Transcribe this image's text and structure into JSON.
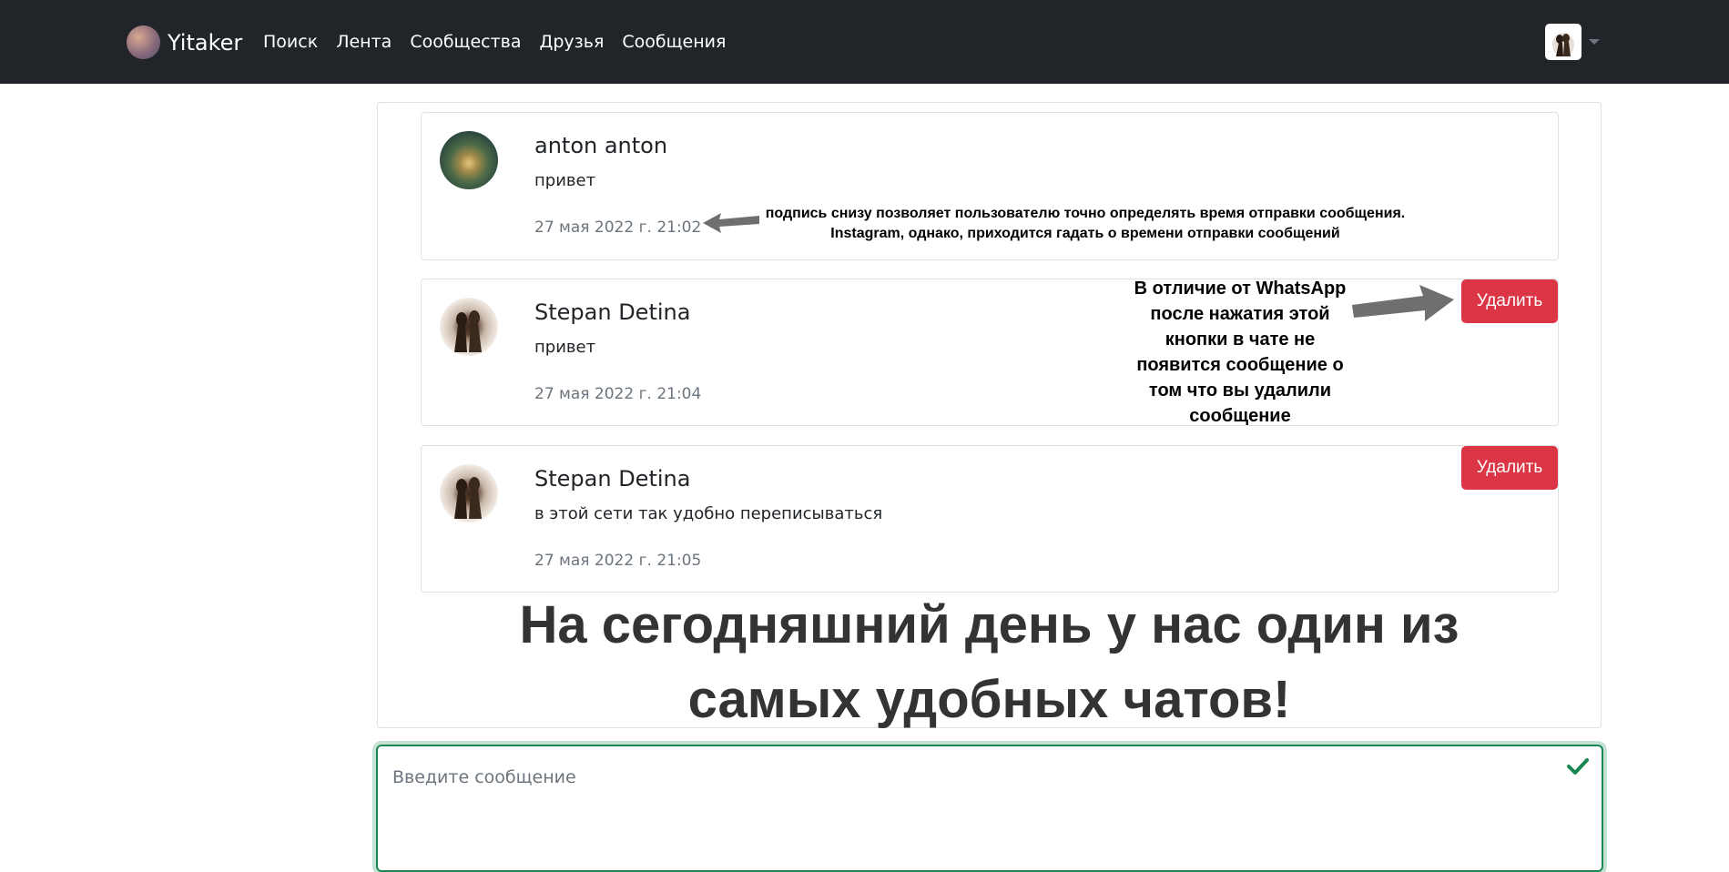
{
  "navbar": {
    "brand": "Yitaker",
    "links": [
      "Поиск",
      "Лента",
      "Сообщества",
      "Друзья",
      "Сообщения"
    ]
  },
  "messages": [
    {
      "name": "anton anton",
      "text": "привет",
      "time": "27 мая 2022 г. 21:02",
      "avatar": "landscape-avatar",
      "can_delete": false
    },
    {
      "name": "Stepan Detina",
      "text": "привет",
      "time": "27 мая 2022 г. 21:04",
      "avatar": "person-avatar",
      "can_delete": true,
      "delete_label": "Удалить"
    },
    {
      "name": "Stepan Detina",
      "text": "в этой сети так удобно переписываться",
      "time": "27 мая 2022 г. 21:05",
      "avatar": "person-avatar",
      "can_delete": true,
      "delete_label": "Удалить"
    }
  ],
  "annotations": {
    "time_note_line1": "подпись снизу позволяет пользователю точно определять время отправки сообщения.",
    "time_note_line2": "Instagram, однако,  приходится гадать о времени отправки сообщений",
    "delete_note": [
      "В отличие от WhatsApp",
      "после нажатия этой",
      "кнопки в чате не",
      "появится сообщение о",
      "том что вы удалили",
      "сообщение"
    ],
    "headline_line1": "На сегодняшний день у нас один из",
    "headline_line2": "самых удобных чатов!"
  },
  "composer": {
    "placeholder": "Введите сообщение",
    "value": ""
  },
  "colors": {
    "navbar_bg": "#212529",
    "delete_button": "#dc3545",
    "valid_border": "#198754"
  }
}
